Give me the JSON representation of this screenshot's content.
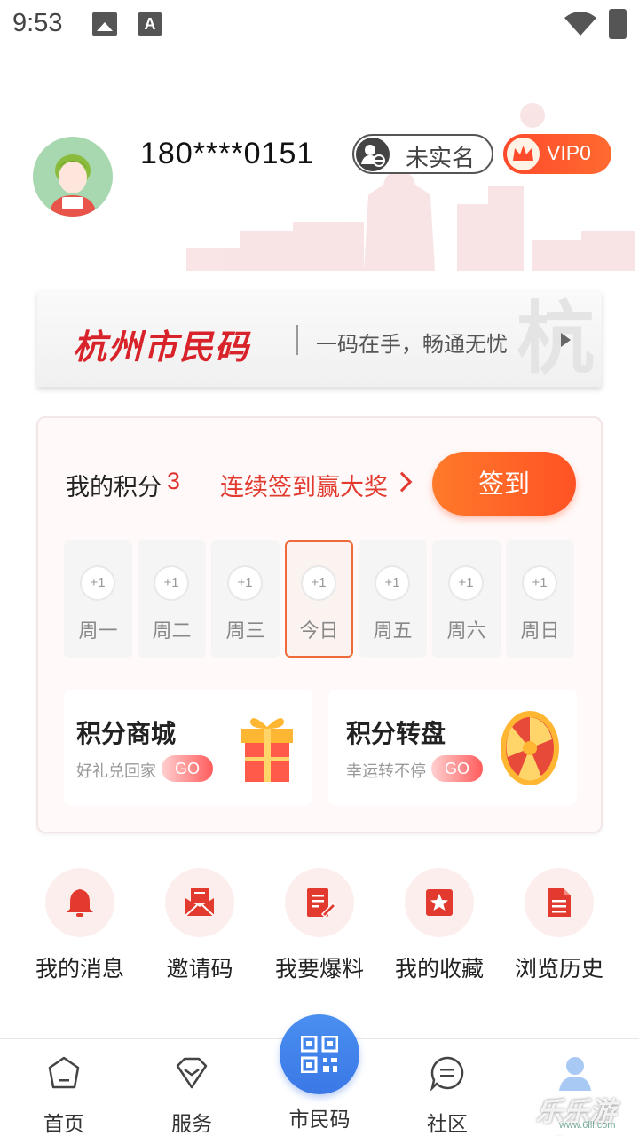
{
  "status_bar": {
    "time": "9:53"
  },
  "profile": {
    "phone": "180****0151",
    "realname_badge": "未实名",
    "vip_badge": "VIP0"
  },
  "banner": {
    "title": "杭州市民码",
    "subtitle": "一码在手，畅通无忧",
    "mark": "杭"
  },
  "points": {
    "label": "我的积分",
    "value": "3",
    "promo": "连续签到赢大奖",
    "sign_button": "签到",
    "days": [
      {
        "bonus": "+1",
        "label": "周一",
        "today": false
      },
      {
        "bonus": "+1",
        "label": "周二",
        "today": false
      },
      {
        "bonus": "+1",
        "label": "周三",
        "today": false
      },
      {
        "bonus": "+1",
        "label": "今日",
        "today": true
      },
      {
        "bonus": "+1",
        "label": "周五",
        "today": false
      },
      {
        "bonus": "+1",
        "label": "周六",
        "today": false
      },
      {
        "bonus": "+1",
        "label": "周日",
        "today": false
      }
    ],
    "mall": {
      "title": "积分商城",
      "subtitle": "好礼兑回家",
      "go": "GO"
    },
    "wheel": {
      "title": "积分转盘",
      "subtitle": "幸运转不停",
      "go": "GO"
    }
  },
  "quick_actions": [
    {
      "label": "我的消息",
      "icon": "bell-icon"
    },
    {
      "label": "邀请码",
      "icon": "envelope-icon"
    },
    {
      "label": "我要爆料",
      "icon": "edit-document-icon"
    },
    {
      "label": "我的收藏",
      "icon": "star-icon"
    },
    {
      "label": "浏览历史",
      "icon": "history-document-icon"
    }
  ],
  "nav": {
    "home": "首页",
    "service": "服务",
    "citizen_code": "市民码",
    "community": "社区",
    "mine": "我的"
  },
  "watermark": {
    "text": "乐乐游戏",
    "url": "www.6lll.com"
  },
  "colors": {
    "accent": "#ff5a28",
    "red": "#e0302b",
    "blue": "#3a78e6"
  }
}
